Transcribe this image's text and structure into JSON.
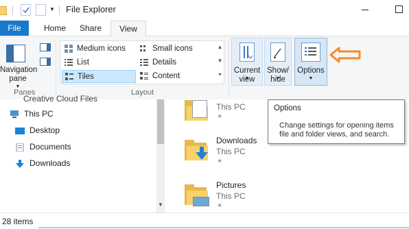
{
  "window": {
    "title": "File Explorer"
  },
  "tabs": [
    "File",
    "Home",
    "Share",
    "View"
  ],
  "ribbon": {
    "panes": {
      "navigation_pane_label": "Navigation pane",
      "group_label": "Panes"
    },
    "layout": {
      "group_label": "Layout",
      "items": [
        "Medium icons",
        "Small icons",
        "List",
        "Details",
        "Tiles",
        "Content"
      ],
      "selected": "Tiles"
    },
    "current_view_label": "Current view",
    "show_hide_label": "Show/ hide",
    "options_label": "Options"
  },
  "nav_tree": {
    "partial_item": "Creative Cloud Files",
    "items": [
      "This PC",
      "Desktop",
      "Documents",
      "Downloads"
    ]
  },
  "main_list": {
    "items": [
      {
        "name": "",
        "sub": "This PC"
      },
      {
        "name": "Downloads",
        "sub": "This PC"
      },
      {
        "name": "Pictures",
        "sub": "This PC"
      }
    ]
  },
  "tooltip": {
    "title": "Options",
    "body": "Change settings for opening items file and folder views, and search."
  },
  "status": {
    "item_count": "28 items"
  },
  "colors": {
    "accent": "#1979ca",
    "annotation_arrow": "#f28c28",
    "folder": "#f7d26c"
  }
}
